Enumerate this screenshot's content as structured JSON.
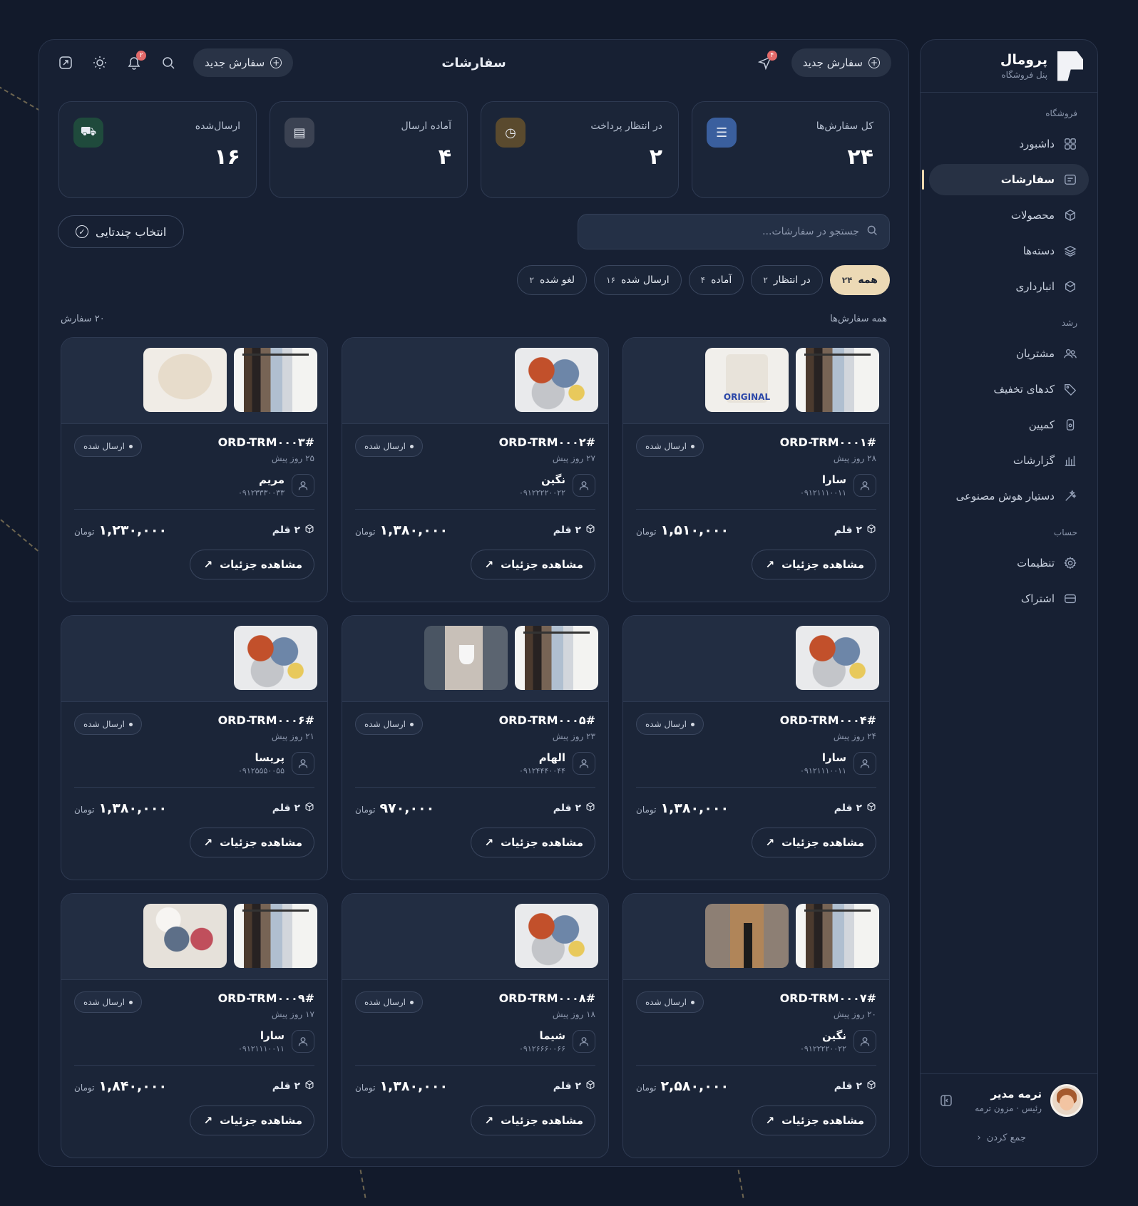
{
  "brand": {
    "name": "پرومال",
    "subtitle": "پنل فروشگاه"
  },
  "nav": {
    "store_label": "فروشگاه",
    "store_items": [
      {
        "label": "داشبورد",
        "icon": "grid-icon"
      },
      {
        "label": "سفارشات",
        "icon": "orders-icon",
        "active": true
      },
      {
        "label": "محصولات",
        "icon": "box-icon"
      },
      {
        "label": "دسته‌ها",
        "icon": "layers-icon"
      },
      {
        "label": "انبارداری",
        "icon": "package-icon"
      }
    ],
    "growth_label": "رشد",
    "growth_items": [
      {
        "label": "مشتریان",
        "icon": "users-icon"
      },
      {
        "label": "کدهای تخفیف",
        "icon": "tag-icon"
      },
      {
        "label": "کمپین",
        "icon": "campaign-icon"
      },
      {
        "label": "گزارشات",
        "icon": "chart-icon"
      },
      {
        "label": "دستیار هوش مصنوعی",
        "icon": "ai-icon"
      }
    ],
    "account_label": "حساب",
    "account_items": [
      {
        "label": "تنظیمات",
        "icon": "gear-icon"
      },
      {
        "label": "اشتراک",
        "icon": "card-icon"
      }
    ]
  },
  "user": {
    "name": "ترمه مدیر",
    "role": "رئیس · مزون ترمه",
    "collapse_label": "جمع کردن"
  },
  "header": {
    "title": "سفارشات",
    "new_order_label": "سفارش جدید",
    "notif_badge": "۴",
    "bell_badge": "۲"
  },
  "stats": [
    {
      "label": "کل سفارش‌ها",
      "value": "۲۴",
      "icon": "list-icon",
      "color": "#3a5f9e"
    },
    {
      "label": "در انتظار پرداخت",
      "value": "۲",
      "icon": "clock-icon",
      "color": "#5a4a2e"
    },
    {
      "label": "آماده ارسال",
      "value": "۴",
      "icon": "archive-icon",
      "color": "#3b4252"
    },
    {
      "label": "ارسال‌شده",
      "value": "۱۶",
      "icon": "cart-icon",
      "color": "#1f4a3c"
    }
  ],
  "search": {
    "placeholder": "جستجو در سفارشات..."
  },
  "multi_select_label": "انتخاب چندتایی",
  "filters": [
    {
      "label": "همه",
      "count": "۲۴",
      "active": true
    },
    {
      "label": "در انتظار",
      "count": "۲"
    },
    {
      "label": "آماده",
      "count": "۴"
    },
    {
      "label": "ارسال شده",
      "count": "۱۶"
    },
    {
      "label": "لغو شده",
      "count": "۲"
    }
  ],
  "list": {
    "title": "همه سفارش‌ها",
    "count_label": "۲۰ سفارش"
  },
  "card_labels": {
    "status": "ارسال شده",
    "currency": "تومان",
    "details": "مشاهده جزئیات"
  },
  "orders": [
    {
      "id": "ORD-TRM۰۰۰۱#",
      "time": "۲۸ روز پیش",
      "customer": "سارا",
      "phone": "۰۹۱۲۱۱۱۰۰۱۱",
      "items": "۲ قلم",
      "price": "۱,۵۱۰,۰۰۰",
      "thumbs": [
        "rack",
        "tee"
      ]
    },
    {
      "id": "ORD-TRM۰۰۰۲#",
      "time": "۲۷ روز پیش",
      "customer": "نگین",
      "phone": "۰۹۱۲۲۲۲۰۰۲۲",
      "items": "۲ قلم",
      "price": "۱,۳۸۰,۰۰۰",
      "thumbs": [
        "pile"
      ]
    },
    {
      "id": "ORD-TRM۰۰۰۳#",
      "time": "۲۵ روز پیش",
      "customer": "مریم",
      "phone": "۰۹۱۲۳۳۳۰۰۳۳",
      "items": "۲ قلم",
      "price": "۱,۲۳۰,۰۰۰",
      "thumbs": [
        "rack",
        "knit"
      ]
    },
    {
      "id": "ORD-TRM۰۰۰۴#",
      "time": "۲۴ روز پیش",
      "customer": "سارا",
      "phone": "۰۹۱۲۱۱۱۰۰۱۱",
      "items": "۲ قلم",
      "price": "۱,۳۸۰,۰۰۰",
      "thumbs": [
        "pile"
      ]
    },
    {
      "id": "ORD-TRM۰۰۰۵#",
      "time": "۲۳ روز پیش",
      "customer": "الهام",
      "phone": "۰۹۱۲۴۴۴۰۰۴۴",
      "items": "۲ قلم",
      "price": "۹۷۰,۰۰۰",
      "thumbs": [
        "rack",
        "street"
      ]
    },
    {
      "id": "ORD-TRM۰۰۰۶#",
      "time": "۲۱ روز پیش",
      "customer": "پریسا",
      "phone": "۰۹۱۲۵۵۵۰۰۵۵",
      "items": "۲ قلم",
      "price": "۱,۳۸۰,۰۰۰",
      "thumbs": [
        "pile"
      ]
    },
    {
      "id": "ORD-TRM۰۰۰۷#",
      "time": "۲۰ روز پیش",
      "customer": "نگین",
      "phone": "۰۹۱۲۲۲۲۰۰۲۲",
      "items": "۲ قلم",
      "price": "۲,۵۸۰,۰۰۰",
      "thumbs": [
        "rack",
        "coat"
      ]
    },
    {
      "id": "ORD-TRM۰۰۰۸#",
      "time": "۱۸ روز پیش",
      "customer": "شیما",
      "phone": "۰۹۱۲۶۶۶۰۰۶۶",
      "items": "۲ قلم",
      "price": "۱,۳۸۰,۰۰۰",
      "thumbs": [
        "pile"
      ]
    },
    {
      "id": "ORD-TRM۰۰۰۹#",
      "time": "۱۷ روز پیش",
      "customer": "سارا",
      "phone": "۰۹۱۲۱۱۱۰۰۱۱",
      "items": "۲ قلم",
      "price": "۱,۸۴۰,۰۰۰",
      "thumbs": [
        "rack",
        "flat"
      ]
    }
  ]
}
